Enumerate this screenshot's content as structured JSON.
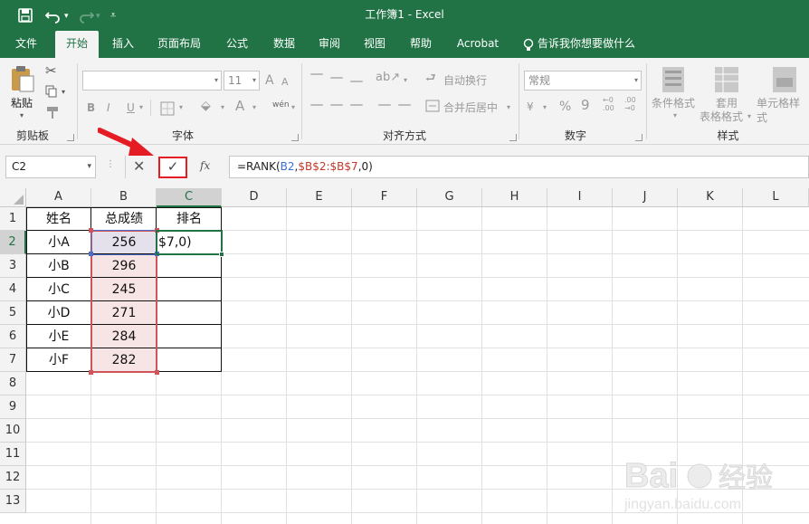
{
  "window": {
    "title": "工作簿1  -  Excel",
    "quick_access": [
      "save-icon",
      "undo-icon",
      "redo-icon",
      "customize-icon"
    ]
  },
  "tabs": [
    {
      "label": "文件",
      "active": false
    },
    {
      "label": "开始",
      "active": true
    },
    {
      "label": "插入",
      "active": false
    },
    {
      "label": "页面布局",
      "active": false
    },
    {
      "label": "公式",
      "active": false
    },
    {
      "label": "数据",
      "active": false
    },
    {
      "label": "审阅",
      "active": false
    },
    {
      "label": "视图",
      "active": false
    },
    {
      "label": "帮助",
      "active": false
    },
    {
      "label": "Acrobat",
      "active": false
    }
  ],
  "tell_me": "告诉我你想要做什么",
  "ribbon": {
    "clipboard": {
      "paste_label": "粘贴",
      "group_label": "剪贴板"
    },
    "font": {
      "font_size": "11",
      "bold": "B",
      "italic": "I",
      "underline": "U",
      "font_color": "A",
      "grow": "A",
      "shrink": "A",
      "phonetic": "wén",
      "group_label": "字体"
    },
    "alignment": {
      "wrap_text": "自动换行",
      "merge_center": "合并后居中",
      "group_label": "对齐方式"
    },
    "number": {
      "format_value": "常规",
      "percent": "%",
      "comma": "9",
      "group_label": "数字"
    },
    "styles": {
      "conditional_format": "条件格式",
      "table_format_1": "套用",
      "table_format_2": "表格格式",
      "cell_styles": "单元格样式",
      "group_label": "样式"
    }
  },
  "formula_bar": {
    "name_box": "C2",
    "cancel": "✕",
    "confirm": "✓",
    "fx": "fx",
    "formula_parts": [
      {
        "text": "=RANK(",
        "color": "#222222"
      },
      {
        "text": "B2",
        "color": "#3a6fd8"
      },
      {
        "text": ",",
        "color": "#222222"
      },
      {
        "text": "$B$2:$B$7",
        "color": "#c0392b"
      },
      {
        "text": ",0)",
        "color": "#222222"
      }
    ]
  },
  "columns": [
    "A",
    "B",
    "C",
    "D",
    "E",
    "F",
    "G",
    "H",
    "I",
    "J",
    "K",
    "L"
  ],
  "rows": [
    "1",
    "2",
    "3",
    "4",
    "5",
    "6",
    "7",
    "8",
    "9",
    "10",
    "11",
    "12",
    "13"
  ],
  "table": {
    "headers": [
      "姓名",
      "总成绩",
      "排名"
    ],
    "data": [
      [
        "小A",
        "256",
        "$7,0)"
      ],
      [
        "小B",
        "296",
        ""
      ],
      [
        "小C",
        "245",
        ""
      ],
      [
        "小D",
        "271",
        ""
      ],
      [
        "小E",
        "284",
        ""
      ],
      [
        "小F",
        "282",
        ""
      ]
    ]
  },
  "colors": {
    "accent": "#217346",
    "reference_range": "#c0392b",
    "reference_cell": "#3a6fd8",
    "highlight": "#e51c23"
  },
  "watermark": {
    "brand": "Bai",
    "product": "经验",
    "url": "jingyan.baidu.com"
  }
}
